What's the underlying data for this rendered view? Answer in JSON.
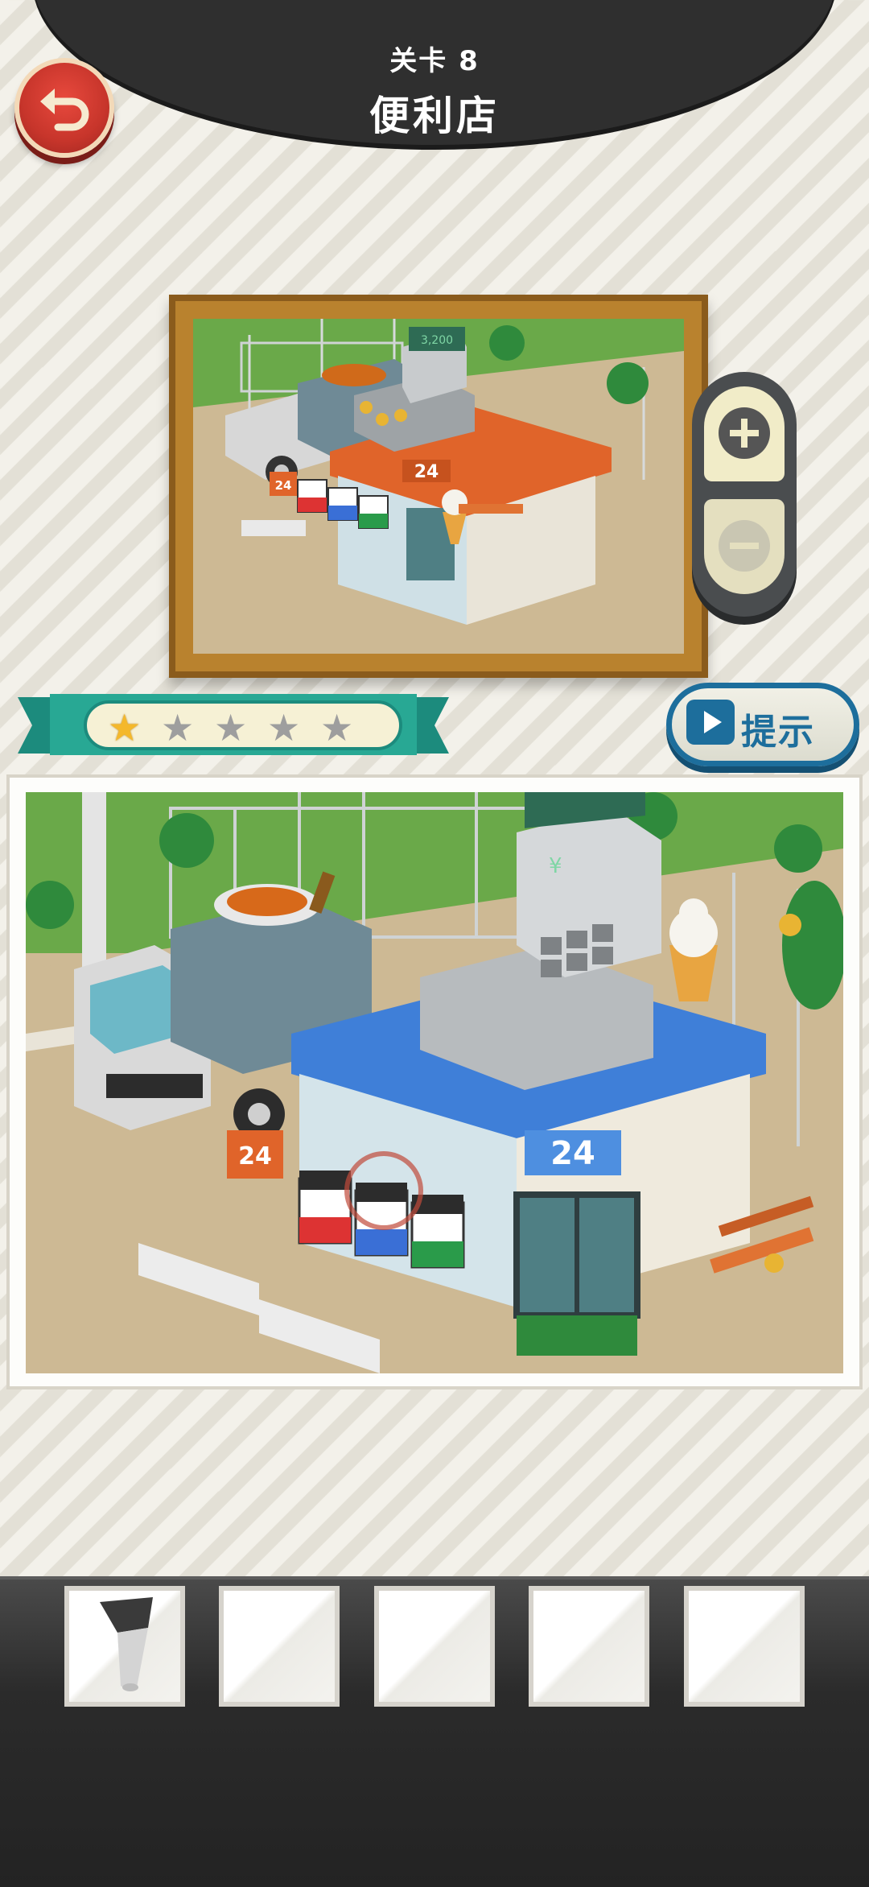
{
  "header": {
    "level_label": "关卡 8",
    "level_title": "便利店"
  },
  "buttons": {
    "hint_label": "提示"
  },
  "rating": {
    "stars_earned": 1,
    "stars_total": 5
  },
  "scene": {
    "store_sign": "24",
    "curb_sign": "24",
    "register_currency": "¥",
    "register_amount": "3,200"
  },
  "inventory": {
    "slots": [
      {
        "item_icon": "tube-nozzle-icon"
      },
      {
        "item_icon": ""
      },
      {
        "item_icon": ""
      },
      {
        "item_icon": ""
      },
      {
        "item_icon": ""
      }
    ]
  },
  "colors": {
    "header_dark": "#2f2f2f",
    "back_red": "#c7352b",
    "frame_wood": "#b9822e",
    "ribbon_teal": "#1c8b7d",
    "hint_blue": "#1d6e9c",
    "ref_roof": "#e0642a",
    "main_roof": "#3f7fd8",
    "star_gold": "#f4b82b"
  }
}
